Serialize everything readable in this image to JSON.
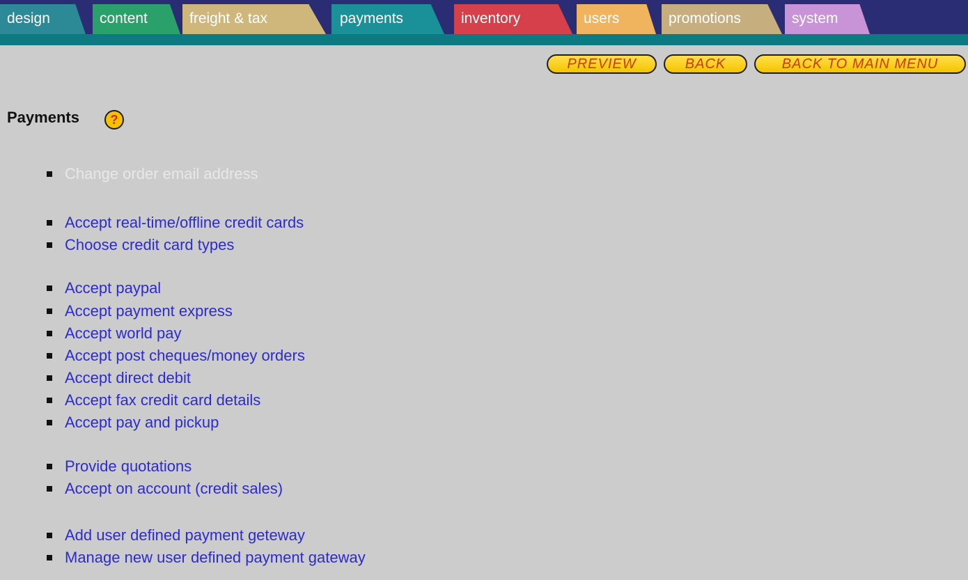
{
  "tabs": [
    {
      "label": "design"
    },
    {
      "label": "content"
    },
    {
      "label": "freight & tax"
    },
    {
      "label": "payments"
    },
    {
      "label": "inventory"
    },
    {
      "label": "users"
    },
    {
      "label": "promotions"
    },
    {
      "label": "system"
    }
  ],
  "actions": {
    "preview": "PREVIEW",
    "back": "BACK",
    "back_to_main_menu": "BACK TO MAIN MENU"
  },
  "page": {
    "title": "Payments",
    "help_icon": "help-icon",
    "menu_items": [
      {
        "label": "Change order email address",
        "state": "disabled"
      },
      {
        "label": "Accept real-time/offline credit cards"
      },
      {
        "label": "Choose credit card types"
      },
      {
        "label": "Accept paypal"
      },
      {
        "label": "Accept payment express"
      },
      {
        "label": "Accept world pay"
      },
      {
        "label": "Accept post cheques/money orders"
      },
      {
        "label": "Accept direct debit"
      },
      {
        "label": "Accept fax credit card details"
      },
      {
        "label": "Accept pay and pickup"
      },
      {
        "label": "Provide quotations"
      },
      {
        "label": "Accept on account (credit sales)"
      },
      {
        "label": "Add user defined payment geteway"
      },
      {
        "label": "Manage new user defined payment gateway"
      }
    ]
  },
  "colors": {
    "background": "#cccccc",
    "tabbar": "#2a2d73",
    "strip": "#0c7a80",
    "link": "#2c2bd2",
    "disabled_link": "#e8e8e8",
    "button_fill": "#f4c400",
    "button_text": "#cc3a00"
  }
}
